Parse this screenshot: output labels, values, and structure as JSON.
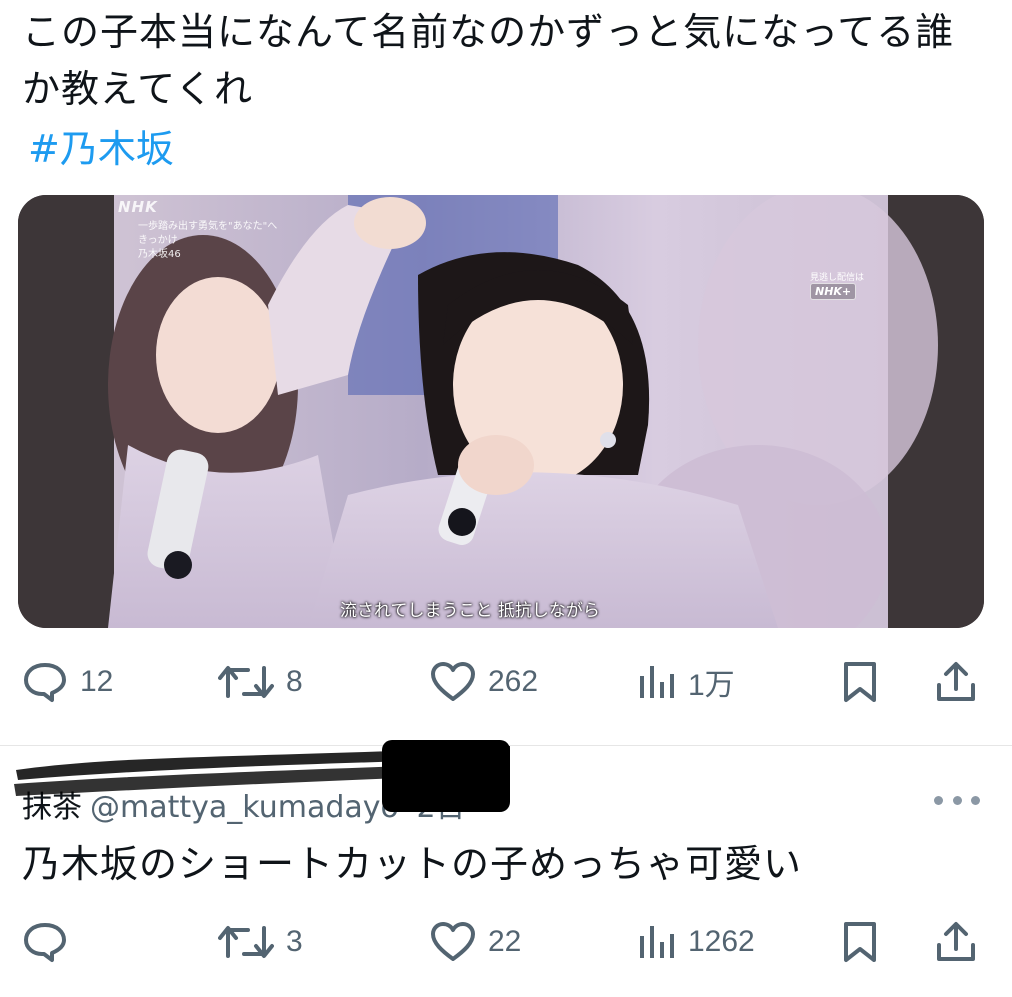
{
  "tweet": {
    "text": "この子本当になんて名前なのかずっと気になってる誰か教えてくれ",
    "hashtag": "#乃木坂",
    "media": {
      "broadcaster_logo": "NHK",
      "overlay_line1": "一歩踏み出す勇気を\"あなた\"へ",
      "overlay_line2": "きっかけ",
      "overlay_line3": "乃木坂46",
      "nhk_plus_label": "見逃し配信は",
      "nhk_plus_logo": "NHK+",
      "subtitle": "流されてしまうこと 抵抗しながら"
    },
    "actions": {
      "reply_icon": "reply-bubble-icon",
      "reply_count": "12",
      "retweet_icon": "retweet-icon",
      "retweet_count": "8",
      "like_icon": "heart-icon",
      "like_count": "262",
      "views_icon": "views-bar-chart-icon",
      "views_count": "1万",
      "bookmark_icon": "bookmark-icon",
      "share_icon": "share-upload-icon"
    }
  },
  "reply": {
    "name": "抹茶",
    "handle": "@mattya_kumadayo",
    "separator": "·",
    "time": "2日",
    "text": "乃木坂のショートカットの子めっちゃ可愛い",
    "more_icon": "more-dots-icon",
    "actions": {
      "reply_count": "",
      "retweet_count": "3",
      "like_count": "22",
      "views_count": "1262"
    }
  },
  "colors": {
    "text_primary": "#0f1419",
    "text_secondary": "#536471",
    "link": "#1d9bf0",
    "divider": "#e6e6e6"
  }
}
